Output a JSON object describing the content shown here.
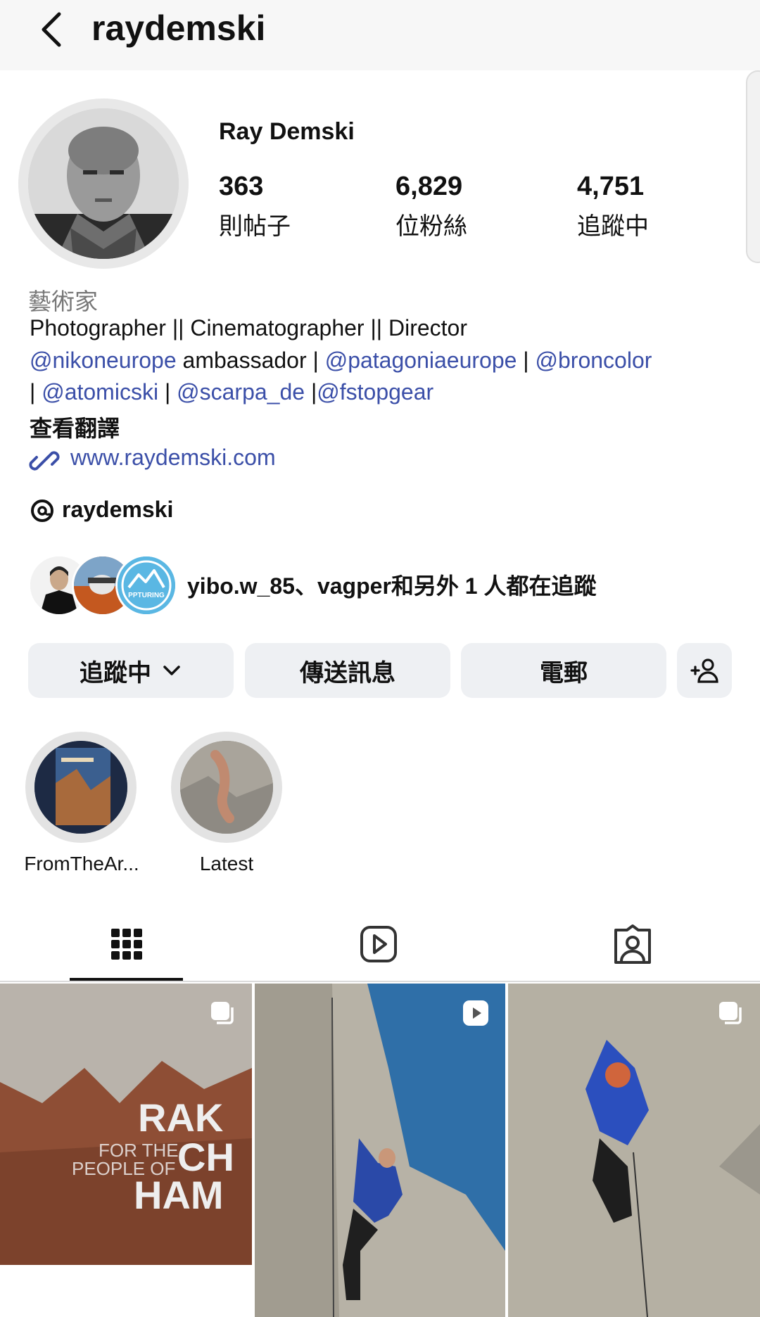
{
  "header": {
    "username": "raydemski"
  },
  "profile": {
    "display_name": "Ray Demski",
    "stats": {
      "posts_count": "363",
      "posts_label": "則帖子",
      "followers_count": "6,829",
      "followers_label": "位粉絲",
      "following_count": "4,751",
      "following_label": "追蹤中"
    },
    "category": "藝術家",
    "bio": {
      "line1": "Photographer || Cinematographer || Director",
      "mention_nikon": "@nikoneurope",
      "ambassador": " ambassador | ",
      "mention_patagonia": "@patagoniaeurope",
      "sep1": " | ",
      "mention_broncolor": "@broncolor",
      "sep2": "| ",
      "mention_atomic": "@atomicski",
      "sep3": " | ",
      "mention_scarpa": "@scarpa_de",
      "sep4": " |",
      "mention_fstop": "@fstopgear"
    },
    "translate_label": "查看翻譯",
    "website": "www.raydemski.com",
    "threads_handle": "raydemski"
  },
  "mutual": {
    "text": "yibo.w_85、vagper和另外 1 人都在追蹤",
    "badge_text": "PPTURING"
  },
  "actions": {
    "following_label": "追蹤中",
    "message_label": "傳送訊息",
    "email_label": "電郵"
  },
  "highlights": [
    {
      "label": "FromTheAr..."
    },
    {
      "label": "Latest"
    }
  ],
  "tabs": [
    "grid",
    "reels",
    "tagged"
  ],
  "posts": {
    "tile1_title_a": "RAK",
    "tile1_title_b": "CH",
    "tile1_title_c": "HAM",
    "tile1_sub_a": "FOR THE",
    "tile1_sub_b": "PEOPLE OF"
  },
  "colors": {
    "link": "#3b4fa8",
    "button_bg": "#eef0f3",
    "text": "#111111"
  }
}
